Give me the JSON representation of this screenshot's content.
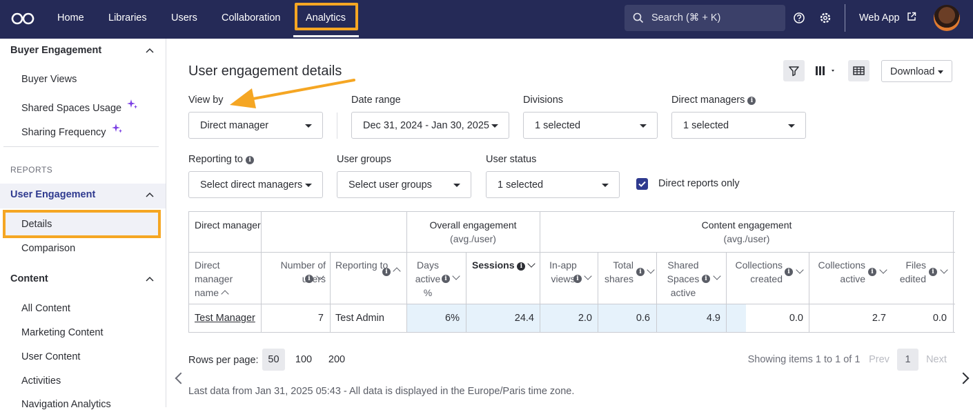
{
  "nav": {
    "items": [
      "Home",
      "Libraries",
      "Users",
      "Collaboration",
      "Analytics"
    ],
    "search_placeholder": "Search (⌘ + K)",
    "web_app": "Web App"
  },
  "sidebar": {
    "buyer_engagement": "Buyer Engagement",
    "buyer_items": [
      "Buyer Views",
      "Shared Spaces Usage",
      "Sharing Frequency"
    ],
    "reports": "REPORTS",
    "user_engagement": "User Engagement",
    "ue_items": [
      "Details",
      "Comparison"
    ],
    "content": "Content",
    "content_items": [
      "All Content",
      "Marketing Content",
      "User Content",
      "Activities",
      "Navigation Analytics"
    ]
  },
  "main": {
    "title": "User engagement details",
    "download": "Download",
    "filters": {
      "view_by_label": "View by",
      "view_by_value": "Direct manager",
      "date_range_label": "Date range",
      "date_range_value": "Dec 31, 2024 - Jan 30, 2025",
      "divisions_label": "Divisions",
      "divisions_value": "1 selected",
      "direct_managers_label": "Direct managers",
      "direct_managers_value": "1 selected",
      "reporting_to_label": "Reporting to",
      "reporting_to_value": "Select direct managers",
      "user_groups_label": "User groups",
      "user_groups_value": "Select user groups",
      "user_status_label": "User status",
      "user_status_value": "1 selected",
      "direct_reports_only": "Direct reports only"
    },
    "table": {
      "group_direct_manager": "Direct manager",
      "group_overall": "Overall engagement",
      "group_overall_sub": "(avg./user)",
      "group_content": "Content engagement",
      "group_content_sub": "(avg./user)",
      "columns": [
        "Direct manager name",
        "Number of users",
        "Reporting to",
        "Days active %",
        "Sessions",
        "In-app views",
        "Total shares",
        "Shared Spaces active",
        "Collections created",
        "Collections active",
        "Files edited"
      ],
      "rows": [
        [
          "Test Manager",
          "7",
          "Test Admin",
          "6%",
          "24.4",
          "2.0",
          "0.6",
          "4.9",
          "0.0",
          "2.7",
          "0.0"
        ]
      ]
    },
    "pagination": {
      "rows_per_page": "Rows per page:",
      "options": [
        "50",
        "100",
        "200"
      ],
      "showing": "Showing items 1 to 1 of 1",
      "prev": "Prev",
      "page": "1",
      "next": "Next"
    },
    "footnote": "Last data from Jan 31, 2025 05:43 - All data is displayed in the Europe/Paris time zone."
  },
  "colors": {
    "nav_bg": "#252a57",
    "highlight": "#f5a623",
    "accent": "#2f3a8f",
    "cell_highlight": "#e6f2fb"
  }
}
